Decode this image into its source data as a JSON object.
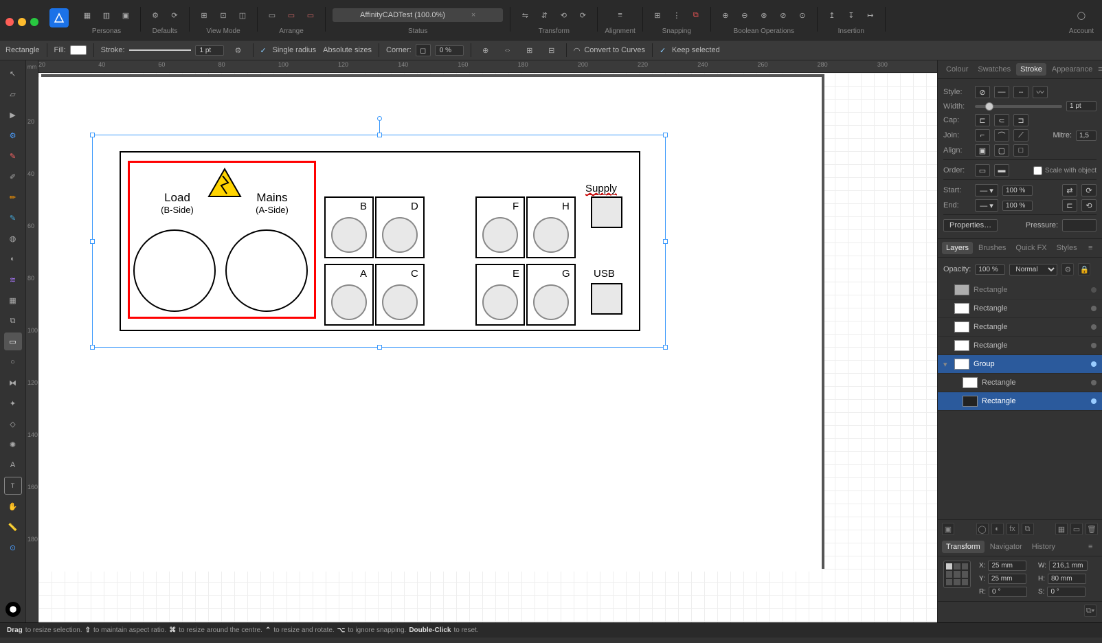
{
  "window": {
    "title": "AffinityCADTest (100.0%)"
  },
  "toolbar_groups": {
    "personas": "Personas",
    "defaults": "Defaults",
    "viewmode": "View Mode",
    "arrange": "Arrange",
    "status": "Status",
    "transform": "Transform",
    "alignment": "Alignment",
    "snapping": "Snapping",
    "boolean": "Boolean Operations",
    "insertion": "Insertion",
    "account": "Account"
  },
  "context": {
    "shape": "Rectangle",
    "fill_label": "Fill:",
    "stroke_label": "Stroke:",
    "stroke_width": "1 pt",
    "single_radius": "Single radius",
    "absolute_sizes": "Absolute sizes",
    "corner_label": "Corner:",
    "corner_value": "0 %",
    "convert": "Convert to Curves",
    "keep_selected": "Keep selected"
  },
  "ruler": {
    "unit": "mm",
    "h_ticks": [
      "20",
      "40",
      "60",
      "80",
      "100",
      "120",
      "140",
      "160",
      "180",
      "200",
      "220",
      "240",
      "260",
      "280",
      "300"
    ],
    "v_ticks": [
      "20",
      "40",
      "60",
      "80",
      "100",
      "120",
      "140",
      "160",
      "180"
    ]
  },
  "drawing": {
    "load": {
      "title": "Load",
      "sub": "(B-Side)"
    },
    "mains": {
      "title": "Mains",
      "sub": "(A-Side)"
    },
    "ports": [
      "B",
      "D",
      "F",
      "H",
      "A",
      "C",
      "E",
      "G"
    ],
    "supply": "Supply",
    "usb": "USB"
  },
  "right": {
    "tabs1": [
      "Colour",
      "Swatches",
      "Stroke",
      "Appearance"
    ],
    "stroke": {
      "style": "Style:",
      "width": "Width:",
      "width_val": "1 pt",
      "cap": "Cap:",
      "join": "Join:",
      "mitre": "Mitre:",
      "mitre_val": "1,5",
      "align": "Align:",
      "order": "Order:",
      "scale": "Scale with object",
      "start": "Start:",
      "end": "End:",
      "pct": "100 %",
      "properties": "Properties…",
      "pressure": "Pressure:"
    },
    "tabs2": [
      "Layers",
      "Brushes",
      "Quick FX",
      "Styles"
    ],
    "opacity_label": "Opacity:",
    "opacity_val": "100 %",
    "blend_mode": "Normal",
    "layers": [
      {
        "name": "Rectangle",
        "indent": 1,
        "sel": false,
        "thumb": "dim"
      },
      {
        "name": "Rectangle",
        "indent": 1,
        "sel": false
      },
      {
        "name": "Rectangle",
        "indent": 1,
        "sel": false
      },
      {
        "name": "Rectangle",
        "indent": 1,
        "sel": false
      },
      {
        "name": "Group",
        "indent": 0,
        "sel": true,
        "chev": true
      },
      {
        "name": "Rectangle",
        "indent": 2,
        "sel": false
      },
      {
        "name": "Rectangle",
        "indent": 2,
        "sel": true,
        "thumb": "dark"
      }
    ],
    "tabs3": [
      "Transform",
      "Navigator",
      "History"
    ],
    "transform": {
      "x_label": "X:",
      "x": "25 mm",
      "y_label": "Y:",
      "y": "25 mm",
      "w_label": "W:",
      "w": "216,1 mm",
      "h_label": "H:",
      "h": "80 mm",
      "r_label": "R:",
      "r": "0 °",
      "s_label": "S:",
      "s": "0 °"
    }
  },
  "status": {
    "drag": "Drag",
    "drag_txt": " to resize selection. ",
    "shift": "⇧",
    "shift_txt": " to maintain aspect ratio. ",
    "cmd": "⌘",
    "cmd_txt": " to resize around the centre. ",
    "alt": "⌃",
    "alt_txt": " to resize and rotate. ",
    "opt": "⌥",
    "opt_txt": " to ignore snapping. ",
    "dbl": "Double-Click",
    "dbl_txt": " to reset."
  }
}
